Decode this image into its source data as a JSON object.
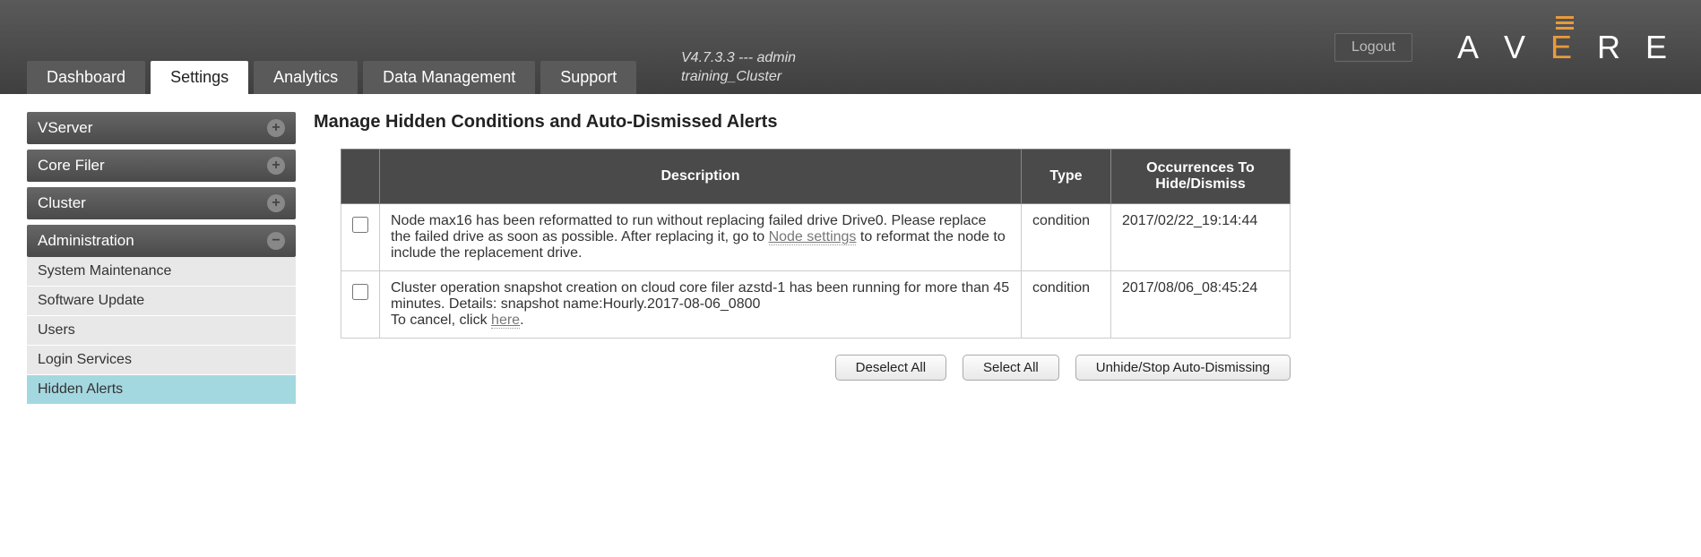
{
  "header": {
    "logout_label": "Logout",
    "version_line": "V4.7.3.3 --- admin",
    "cluster_name": "training_Cluster",
    "logo_letters": [
      "A",
      "V",
      "E",
      "R",
      "E"
    ]
  },
  "tabs": [
    {
      "label": "Dashboard",
      "active": false
    },
    {
      "label": "Settings",
      "active": true
    },
    {
      "label": "Analytics",
      "active": false
    },
    {
      "label": "Data Management",
      "active": false
    },
    {
      "label": "Support",
      "active": false
    }
  ],
  "sidebar": {
    "groups": [
      {
        "label": "VServer",
        "expanded": false,
        "items": []
      },
      {
        "label": "Core Filer",
        "expanded": false,
        "items": []
      },
      {
        "label": "Cluster",
        "expanded": false,
        "items": []
      },
      {
        "label": "Administration",
        "expanded": true,
        "items": [
          {
            "label": "System Maintenance",
            "active": false
          },
          {
            "label": "Software Update",
            "active": false
          },
          {
            "label": "Users",
            "active": false
          },
          {
            "label": "Login Services",
            "active": false
          },
          {
            "label": "Hidden Alerts",
            "active": true
          }
        ]
      }
    ]
  },
  "main": {
    "title": "Manage Hidden Conditions and Auto-Dismissed Alerts",
    "columns": {
      "checkbox": "",
      "description": "Description",
      "type": "Type",
      "occurrences": "Occurrences To Hide/Dismiss"
    },
    "rows": [
      {
        "desc_pre": "Node max16 has been reformatted to run without replacing failed drive Drive0. Please replace the failed drive as soon as possible. After replacing it, go to ",
        "desc_link": "Node settings",
        "desc_post": " to reformat the node to include the replacement drive.",
        "type": "condition",
        "timestamp": "2017/02/22_19:14:44"
      },
      {
        "desc_pre": "Cluster operation snapshot creation on cloud core filer azstd-1 has been running for more than 45 minutes. Details: snapshot name:Hourly.2017-08-06_0800\nTo cancel, click ",
        "desc_link": "here",
        "desc_post": ".",
        "type": "condition",
        "timestamp": "2017/08/06_08:45:24"
      }
    ],
    "actions": {
      "deselect_all": "Deselect All",
      "select_all": "Select All",
      "unhide": "Unhide/Stop Auto-Dismissing"
    }
  }
}
